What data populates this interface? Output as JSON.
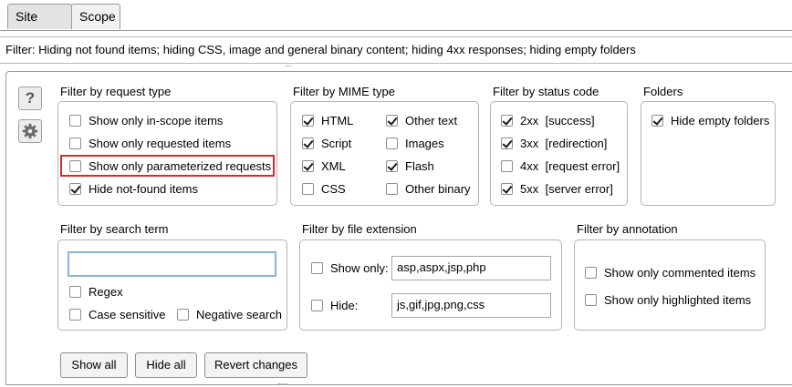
{
  "tabs": [
    {
      "label": "Site map",
      "active": true
    },
    {
      "label": "Scope",
      "active": false
    }
  ],
  "filter_summary": "Filter: Hiding not found items;  hiding CSS, image and general binary content;  hiding 4xx responses;  hiding empty folders",
  "side_buttons": [
    {
      "icon": "help-icon",
      "glyph": "?"
    },
    {
      "icon": "gear-icon"
    }
  ],
  "request_type": {
    "title": "Filter by request type",
    "items": [
      {
        "label": "Show only in-scope items",
        "checked": false
      },
      {
        "label": "Show only requested items",
        "checked": false
      },
      {
        "label": "Show only parameterized requests",
        "checked": false,
        "highlighted": true
      },
      {
        "label": "Hide not-found items",
        "checked": true
      }
    ]
  },
  "mime_type": {
    "title": "Filter by MIME type",
    "items": [
      {
        "label": "HTML",
        "checked": true
      },
      {
        "label": "Script",
        "checked": true
      },
      {
        "label": "XML",
        "checked": true
      },
      {
        "label": "CSS",
        "checked": false
      },
      {
        "label": "Other text",
        "checked": true
      },
      {
        "label": "Images",
        "checked": false
      },
      {
        "label": "Flash",
        "checked": true
      },
      {
        "label": "Other binary",
        "checked": false
      }
    ]
  },
  "status_code": {
    "title": "Filter by status code",
    "items": [
      {
        "label": "2xx  [success]",
        "checked": true
      },
      {
        "label": "3xx  [redirection]",
        "checked": true
      },
      {
        "label": "4xx  [request error]",
        "checked": false
      },
      {
        "label": "5xx  [server error]",
        "checked": true
      }
    ]
  },
  "folders": {
    "title": "Folders",
    "items": [
      {
        "label": "Hide empty folders",
        "checked": true
      }
    ]
  },
  "search_term": {
    "title": "Filter by search term",
    "value": "",
    "items": [
      {
        "label": "Regex",
        "checked": false
      },
      {
        "label": "Case sensitive",
        "checked": false
      },
      {
        "label": "Negative search",
        "checked": false
      }
    ]
  },
  "file_extension": {
    "title": "Filter by file extension",
    "show_only": {
      "label": "Show only:",
      "checked": false,
      "value": "asp,aspx,jsp,php"
    },
    "hide": {
      "label": "Hide:",
      "checked": false,
      "value": "js,gif,jpg,png,css"
    }
  },
  "annotation": {
    "title": "Filter by annotation",
    "items": [
      {
        "label": "Show only commented items",
        "checked": false
      },
      {
        "label": "Show only highlighted items",
        "checked": false
      }
    ]
  },
  "buttons": {
    "show_all": "Show all",
    "hide_all": "Hide all",
    "revert": "Revert changes"
  }
}
